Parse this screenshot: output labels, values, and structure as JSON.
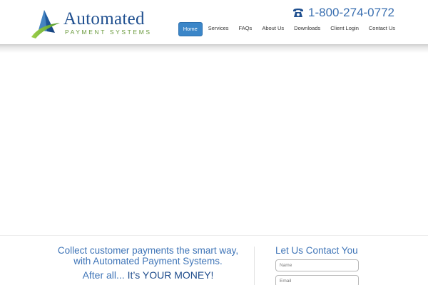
{
  "brand": {
    "name": "Automated",
    "subtitle": "Payment Systems",
    "colors": {
      "primary": "#1f4f8f",
      "accent": "#6a9a3c",
      "link": "#3e74b7"
    }
  },
  "header": {
    "phone": "1-800-274-0772",
    "phone_icon": "telephone-icon"
  },
  "nav": {
    "items": [
      {
        "label": "Home",
        "active": true
      },
      {
        "label": "Services",
        "active": false
      },
      {
        "label": "FAQs",
        "active": false
      },
      {
        "label": "About Us",
        "active": false
      },
      {
        "label": "Downloads",
        "active": false
      },
      {
        "label": "Client Login",
        "active": false
      },
      {
        "label": "Contact Us",
        "active": false
      }
    ],
    "active_color": "#3b86c8"
  },
  "tagline": {
    "line1": "Collect customer payments the smart way,",
    "line2": "with Automated Payment Systems.",
    "line3_prefix": "After all... ",
    "line3_emphasis": "It’s YOUR MONEY!"
  },
  "contact_form": {
    "title": "Let Us Contact You",
    "name_placeholder": "Name",
    "email_placeholder": "Email"
  }
}
